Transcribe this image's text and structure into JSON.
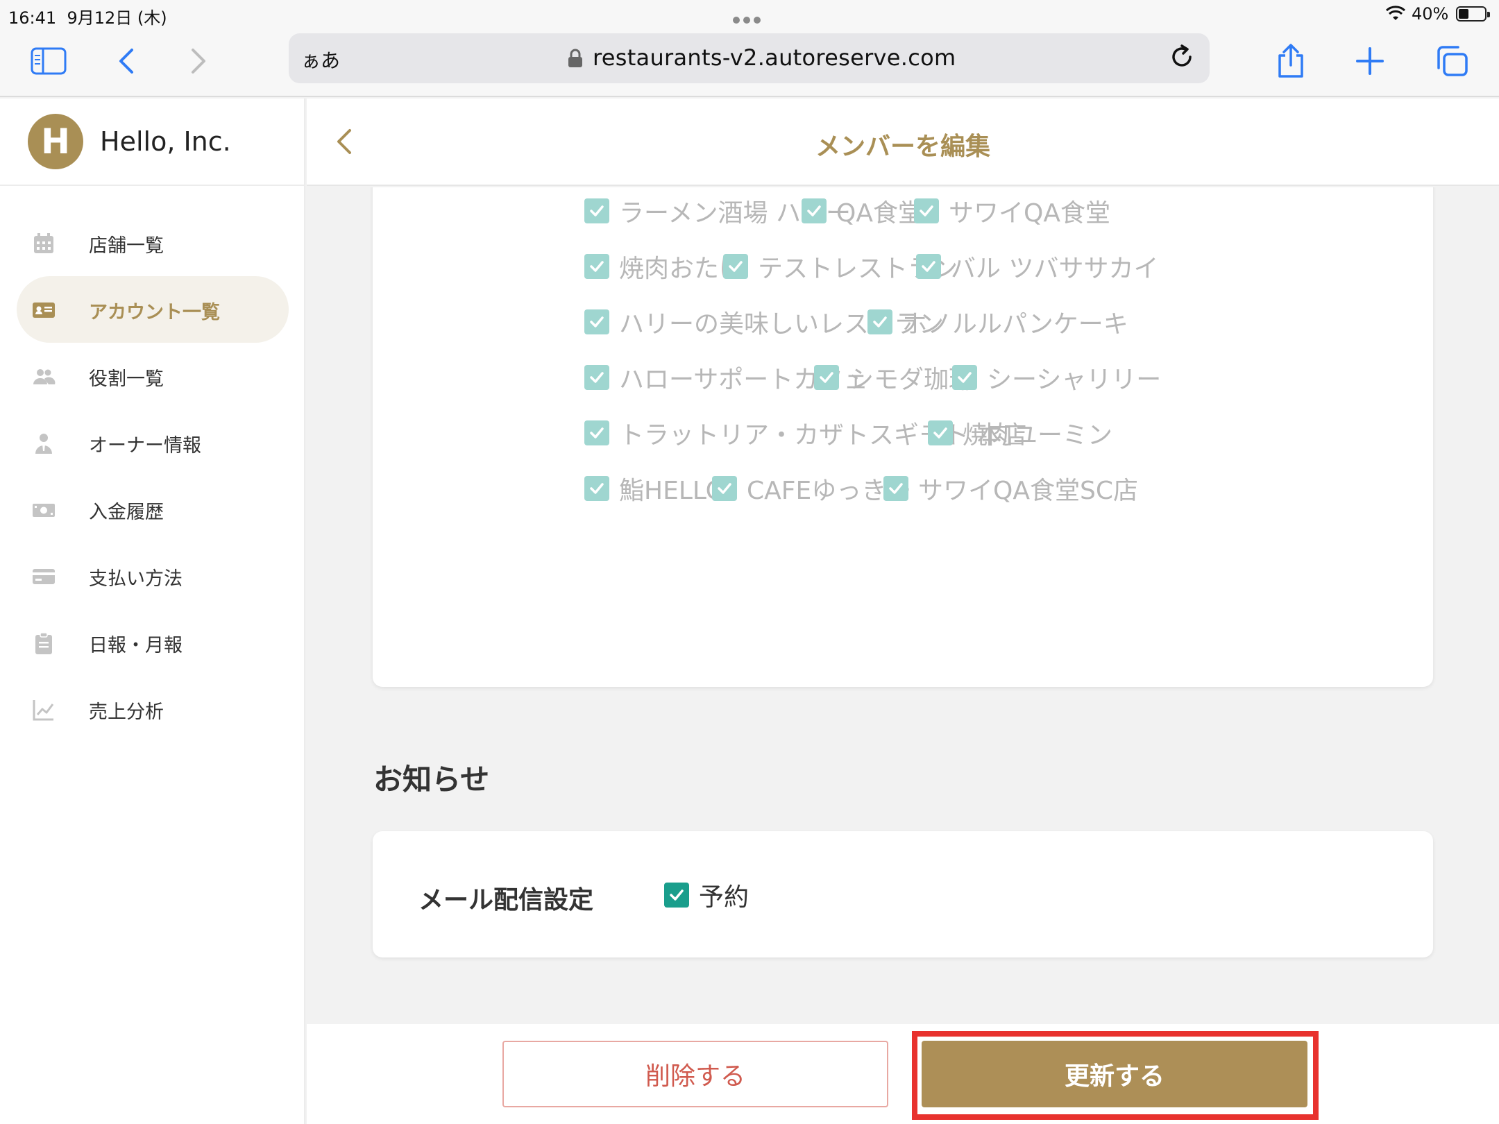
{
  "status_bar": {
    "time": "16:41",
    "date": "9月12日 (木)",
    "battery": "40%"
  },
  "browser": {
    "aa_label": "ぁあ",
    "url": "restaurants-v2.autoreserve.com",
    "icons": [
      "sidebar-icon",
      "back-icon",
      "forward-icon",
      "lock-icon",
      "reload-icon",
      "share-icon",
      "plus-icon",
      "tabs-icon"
    ]
  },
  "brand": {
    "initial": "H",
    "name": "Hello, Inc."
  },
  "sidebar": {
    "items": [
      {
        "label": "店舗一覧",
        "icon": "calendar-icon",
        "active": false
      },
      {
        "label": "アカウント一覧",
        "icon": "id-card-icon",
        "active": true
      },
      {
        "label": "役割一覧",
        "icon": "users-icon",
        "active": false
      },
      {
        "label": "オーナー情報",
        "icon": "owner-icon",
        "active": false
      },
      {
        "label": "入金履歴",
        "icon": "money-icon",
        "active": false
      },
      {
        "label": "支払い方法",
        "icon": "credit-card-icon",
        "active": false
      },
      {
        "label": "日報・月報",
        "icon": "clipboard-icon",
        "active": false
      },
      {
        "label": "売上分析",
        "icon": "chart-icon",
        "active": false
      }
    ]
  },
  "header": {
    "title": "メンバーを編集"
  },
  "stores": {
    "rows": [
      [
        "ラーメン酒場 ハロー",
        "QA食堂",
        "サワイQA食堂"
      ],
      [
        "焼肉おたけ",
        "テストレストラン",
        "バル ツバササカイ"
      ],
      [
        "ハリーの美味しいレストラン",
        "ホノルルパンケーキ"
      ],
      [
        "ハローサポートカフェ",
        "シモダ珈琲",
        "シーシャリリー"
      ],
      [
        "トラットリア・カザトスギモト 本店",
        "焼肉ユーミン"
      ],
      [
        "鮨HELLO",
        "CAFEゆっきー",
        "サワイQA食堂SC店"
      ]
    ],
    "checked": true,
    "disabled": true
  },
  "notifications": {
    "section_title": "お知らせ",
    "mail_label": "メール配信設定",
    "options": [
      {
        "label": "予約",
        "checked": true
      }
    ]
  },
  "footer": {
    "delete_label": "削除する",
    "update_label": "更新する"
  },
  "colors": {
    "accent": "#ad8f57",
    "danger": "#d05a4e",
    "check": "#1a9e8c",
    "highlight": "#e8322e"
  }
}
